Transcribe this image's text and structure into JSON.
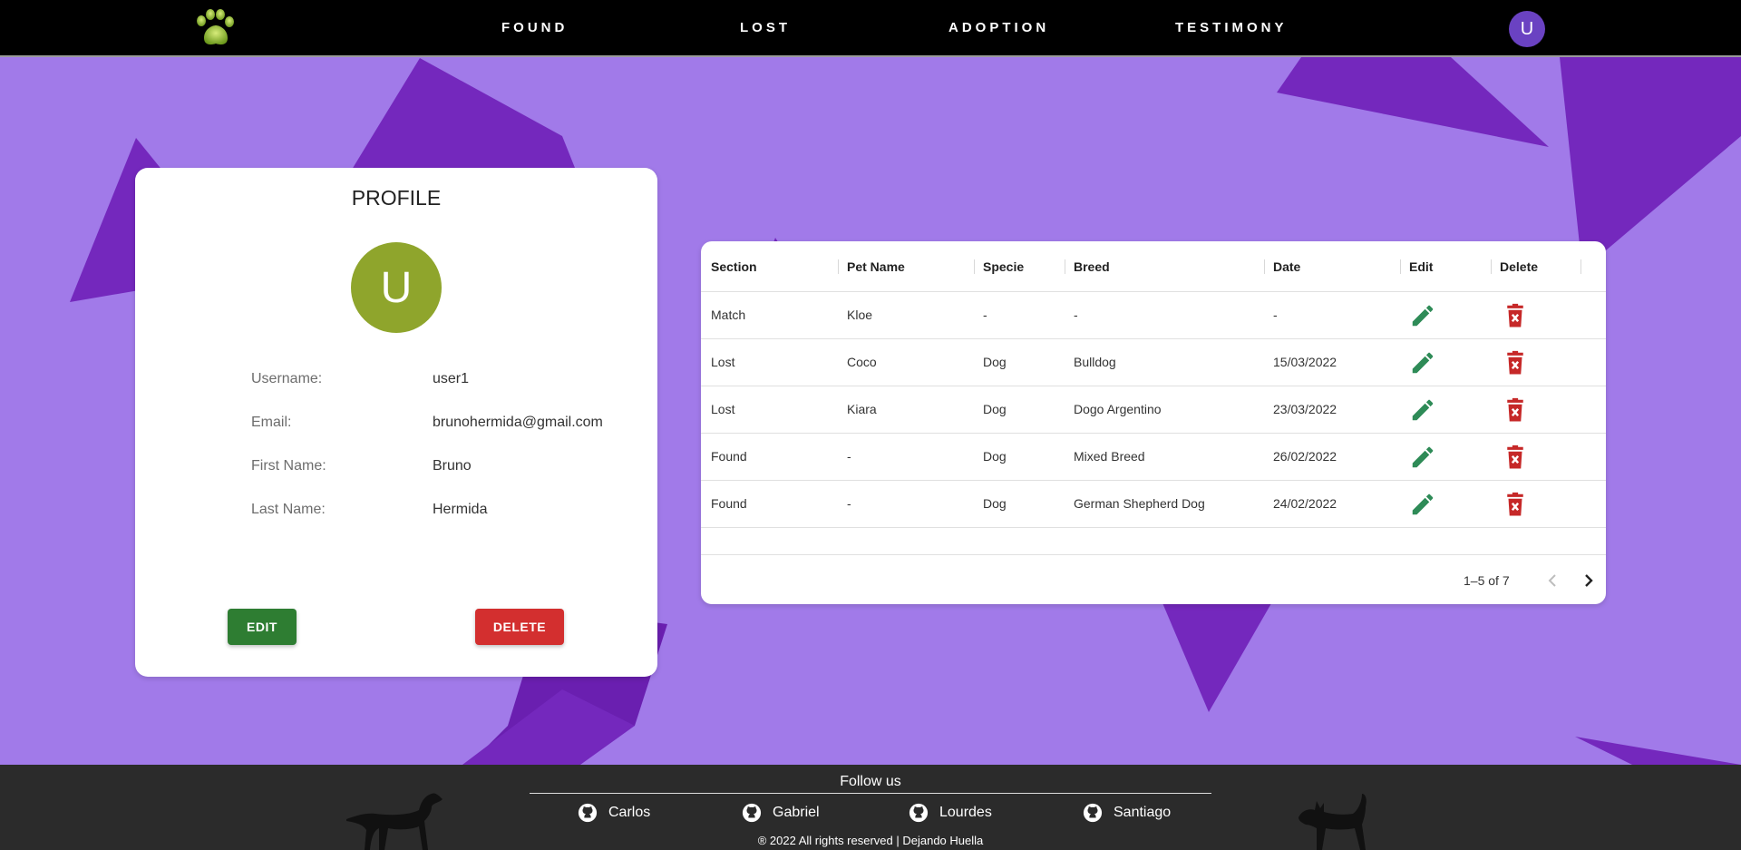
{
  "nav": {
    "links": [
      "FOUND",
      "LOST",
      "ADOPTION",
      "TESTIMONY"
    ],
    "avatar_letter": "U"
  },
  "profile": {
    "title": "PROFILE",
    "avatar_letter": "U",
    "fields": [
      {
        "label": "Username:",
        "value": "user1"
      },
      {
        "label": "Email:",
        "value": "brunohermida@gmail.com"
      },
      {
        "label": "First Name:",
        "value": "Bruno"
      },
      {
        "label": "Last Name:",
        "value": "Hermida"
      }
    ],
    "edit_label": "EDIT",
    "delete_label": "DELETE"
  },
  "table": {
    "columns": [
      "Section",
      "Pet Name",
      "Specie",
      "Breed",
      "Date",
      "Edit",
      "Delete"
    ],
    "rows": [
      [
        "Match",
        "Kloe",
        "-",
        "-",
        "-"
      ],
      [
        "Lost",
        "Coco",
        "Dog",
        "Bulldog",
        "15/03/2022"
      ],
      [
        "Lost",
        "Kiara",
        "Dog",
        "Dogo Argentino",
        "23/03/2022"
      ],
      [
        "Found",
        "-",
        "Dog",
        "Mixed Breed",
        "26/02/2022"
      ],
      [
        "Found",
        "-",
        "Dog",
        "German Shepherd Dog",
        "24/02/2022"
      ]
    ],
    "pagination": "1–5 of 7"
  },
  "footer": {
    "follow": "Follow us",
    "contributors": [
      "Carlos",
      "Gabriel",
      "Lourdes",
      "Santiago"
    ],
    "copyright": "® 2022 All rights reserved | Dejando Huella"
  },
  "colors": {
    "background": "#a17ae9",
    "accent_purple": "#7428bd",
    "edit_green": "#2e8b57",
    "delete_red": "#c62828",
    "avatar_olive": "#8fa52c"
  }
}
